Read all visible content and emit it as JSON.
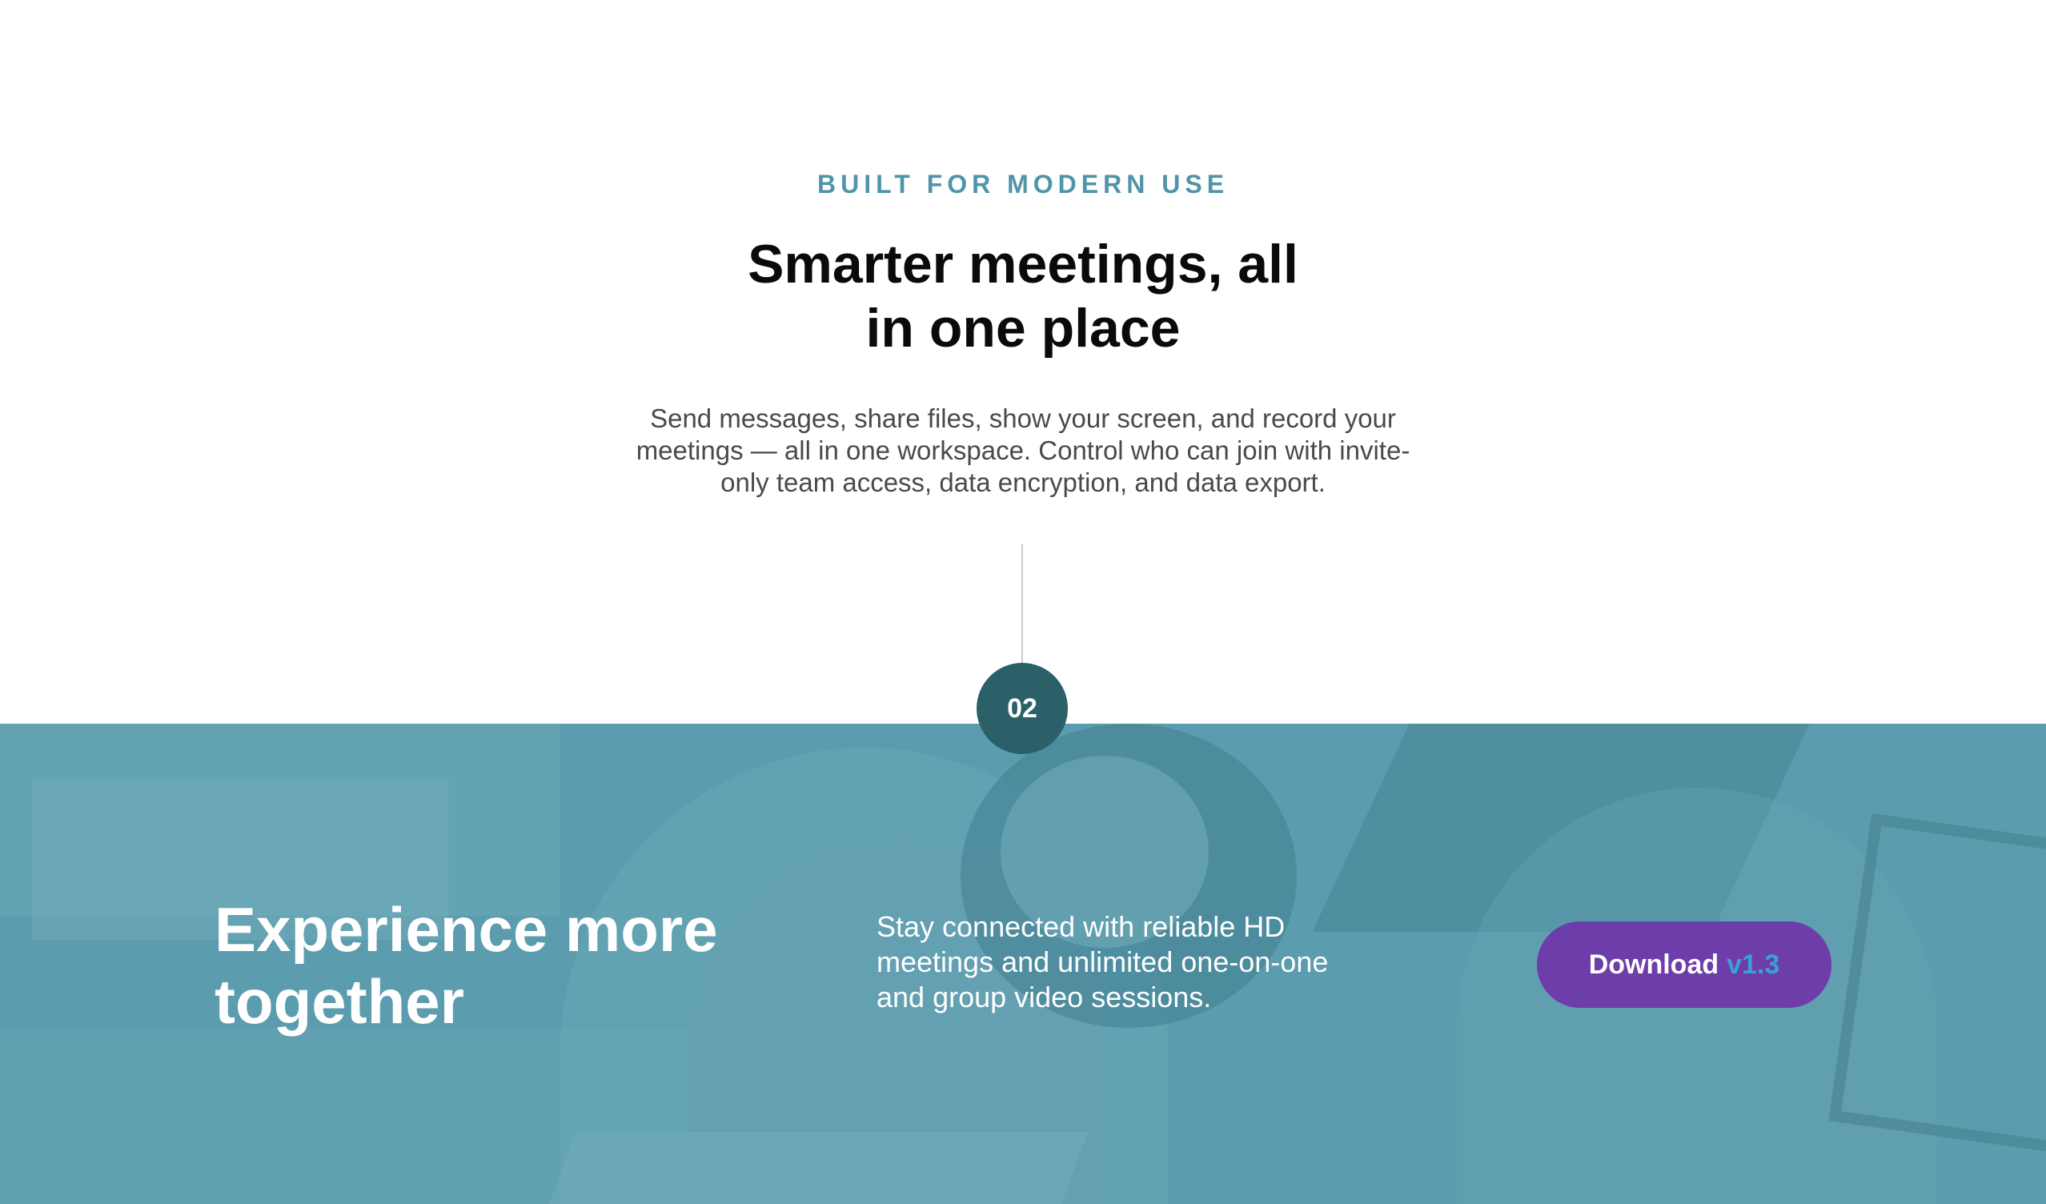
{
  "intro": {
    "eyebrow": "BUILT FOR MODERN USE",
    "headline_line1": "Smarter meetings, all",
    "headline_line2": "in one place",
    "body_line1": "Send messages, share files, show your screen, and record your",
    "body_line2": "meetings — all in one workspace. Control who can join with invite-",
    "body_line3": "only team access, data encryption, and data export."
  },
  "step": {
    "number": "02"
  },
  "feature": {
    "title_line1": "Experience more",
    "title_line2": "together",
    "text_line1": "Stay connected with reliable HD",
    "text_line2": "meetings and unlimited one-on-one",
    "text_line3": "and group video sessions.",
    "button_label": "Download",
    "button_version": "v1.3"
  },
  "colors": {
    "eyebrow": "#4f94a8",
    "band_overlay": "#5b9dae",
    "step_badge": "#2b6069",
    "button": "#6d3daa",
    "button_version": "#3aa1d6"
  }
}
